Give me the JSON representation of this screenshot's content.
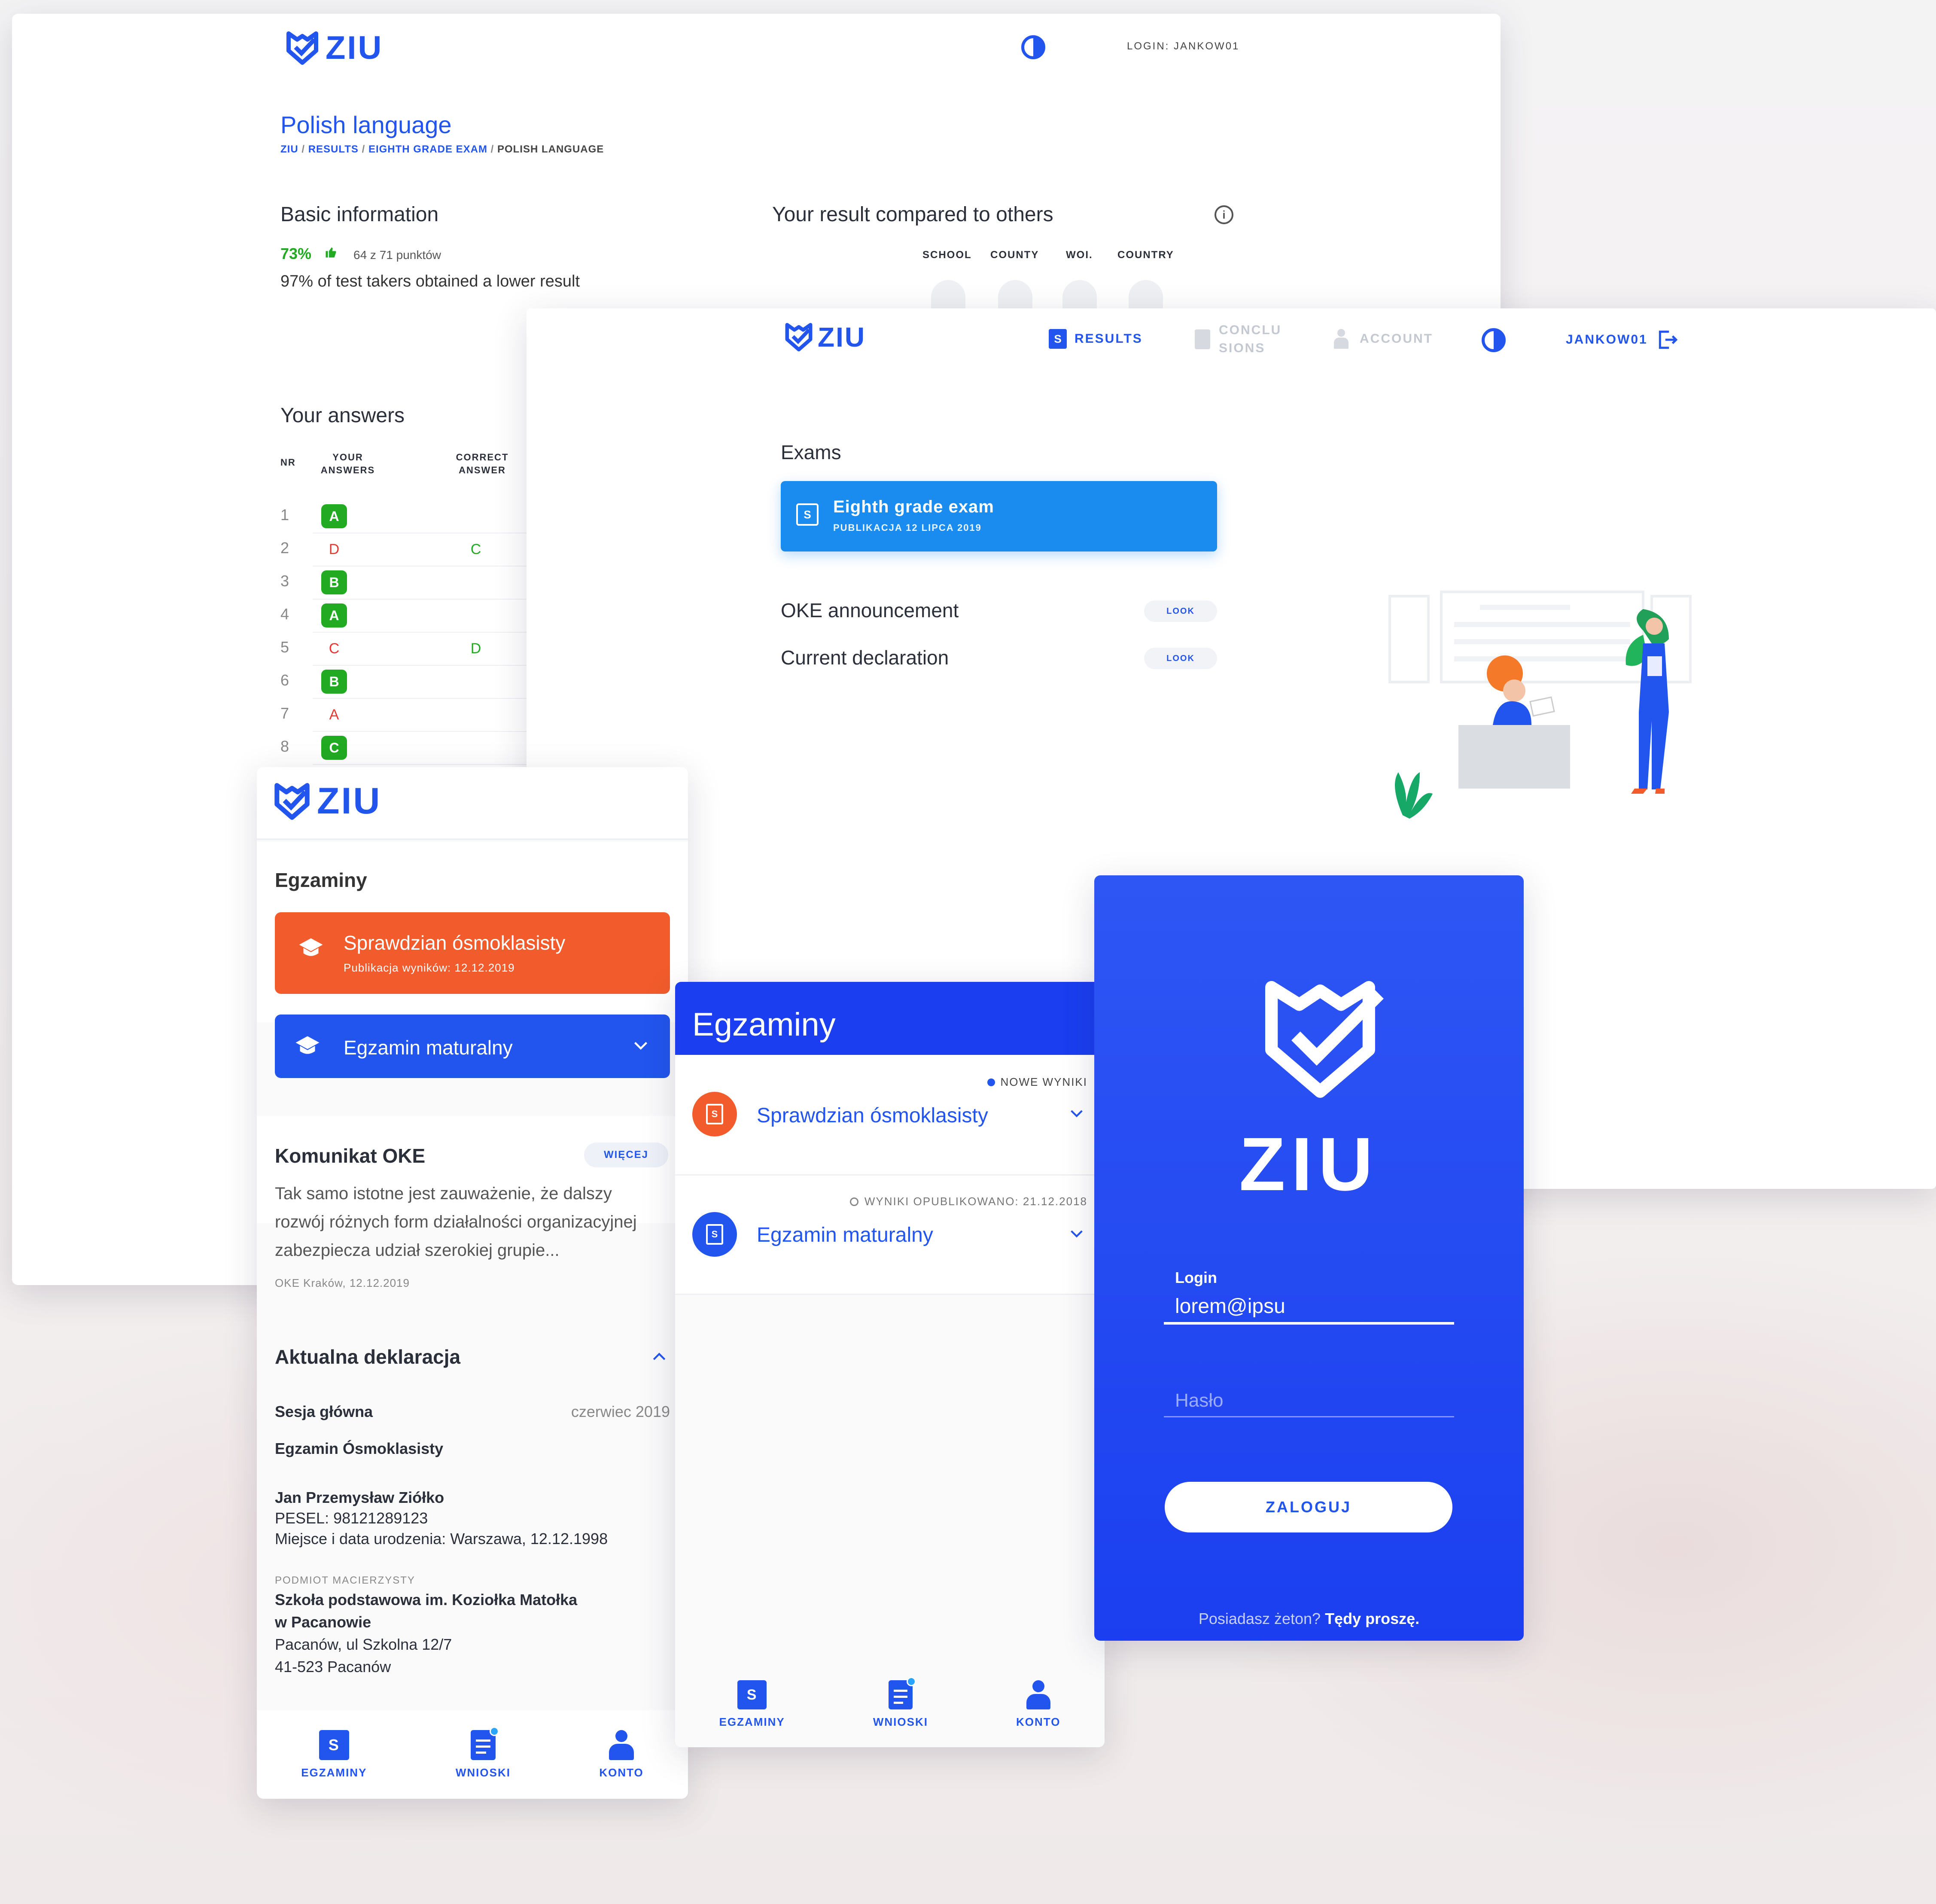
{
  "logo_text": "ZIU",
  "desktop_results": {
    "login_label": "LOGIN: JANKOW01",
    "title": "Polish language",
    "breadcrumb": {
      "ziu": "ZIU",
      "sep1": " / ",
      "results": "RESULTS",
      "sep2": " / ",
      "exam": "EIGHTH GRADE EXAM",
      "sep3": " / ",
      "current": "POLISH LANGUAGE"
    },
    "basic_info_title": "Basic information",
    "percent": "73%",
    "points": "64 z 71 punktów",
    "lower_result": "97% of test takers obtained a lower result",
    "compare_title": "Your result compared to others",
    "compare_cols": [
      "SCHOOL",
      "COUNTY",
      "WOI.",
      "COUNTRY"
    ],
    "answers_title": "Your answers",
    "answers_headers": {
      "nr": "NR",
      "yours": "YOUR ANSWERS",
      "correct": "CORRECT ANSWER"
    },
    "answers": [
      {
        "nr": "1",
        "answer": "A",
        "correct": "",
        "ok": true
      },
      {
        "nr": "2",
        "answer": "D",
        "correct": "C",
        "ok": false
      },
      {
        "nr": "3",
        "answer": "B",
        "correct": "",
        "ok": true
      },
      {
        "nr": "4",
        "answer": "A",
        "correct": "",
        "ok": true
      },
      {
        "nr": "5",
        "answer": "C",
        "correct": "D",
        "ok": false
      },
      {
        "nr": "6",
        "answer": "B",
        "correct": "",
        "ok": true
      },
      {
        "nr": "7",
        "answer": "A",
        "correct": "",
        "ok": false
      },
      {
        "nr": "8",
        "answer": "C",
        "correct": "",
        "ok": true
      }
    ]
  },
  "desktop_exams": {
    "nav": {
      "results": "RESULTS",
      "conclusions_1": "CONCLU",
      "conclusions_2": "SIONS",
      "account": "ACCOUNT",
      "user": "JANKOW01"
    },
    "exams_title": "Exams",
    "exam_card": {
      "title": "Eighth grade exam",
      "subtitle": "PUBLIKACJA 12 LIPCA 2019"
    },
    "links": [
      {
        "label": "OKE announcement",
        "action": "LOOK"
      },
      {
        "label": "Current declaration",
        "action": "LOOK"
      }
    ]
  },
  "mobile_left": {
    "section_title": "Egzaminy",
    "card_orange": {
      "title": "Sprawdzian ósmoklasisty",
      "subtitle": "Publikacja wyników: 12.12.2019"
    },
    "card_blue": {
      "title": "Egzamin maturalny"
    },
    "oke": {
      "title": "Komunikat OKE",
      "more": "WIĘCEJ",
      "body": "Tak samo istotne jest zauważenie, że dalszy rozwój różnych form działalności organizacyjnej zabezpiecza udział szerokiej grupie...",
      "meta": "OKE Kraków, 12.12.2019"
    },
    "declaration": {
      "title": "Aktualna deklaracja",
      "session_label": "Sesja główna",
      "session_value": "czerwiec 2019",
      "exam": "Egzamin Ósmoklasisty",
      "name": "Jan Przemysław Ziółko",
      "pesel": "PESEL: 98121289123",
      "birth": "Miejsce i data urodzenia: Warszawa, 12.12.1998",
      "parent_label": "PODMIOT MACIERZYSTY",
      "school_1": "Szkoła podstawowa im. Koziołka Matołka",
      "school_2": "w Pacanowie",
      "address_1": "Pacanów, ul Szkolna 12/7",
      "address_2": "41-523 Pacanów"
    },
    "nav": [
      "EGZAMINY",
      "WNIOSKI",
      "KONTO"
    ]
  },
  "mobile_mid": {
    "header": "Egzaminy",
    "item1": {
      "badge": "NOWE WYNIKI",
      "title": "Sprawdzian ósmoklasisty"
    },
    "item2": {
      "meta": "WYNIKI OPUBLIKOWANO: 21.12.2018",
      "title": "Egzamin maturalny"
    },
    "nav": [
      "EGZAMINY",
      "WNIOSKI",
      "KONTO"
    ]
  },
  "login": {
    "logo_text": "ZIU",
    "login_label": "Login",
    "login_value": "lorem@ipsu",
    "password_placeholder": "Hasło",
    "submit": "ZALOGUJ",
    "token_text": "Posiadasz żeton?",
    "token_link": "Tędy proszę."
  },
  "colors": {
    "primary": "#2255ee",
    "orange": "#f25c2c",
    "green": "#22aa22",
    "red": "#e53935",
    "exam_card": "#1a8cf0"
  }
}
